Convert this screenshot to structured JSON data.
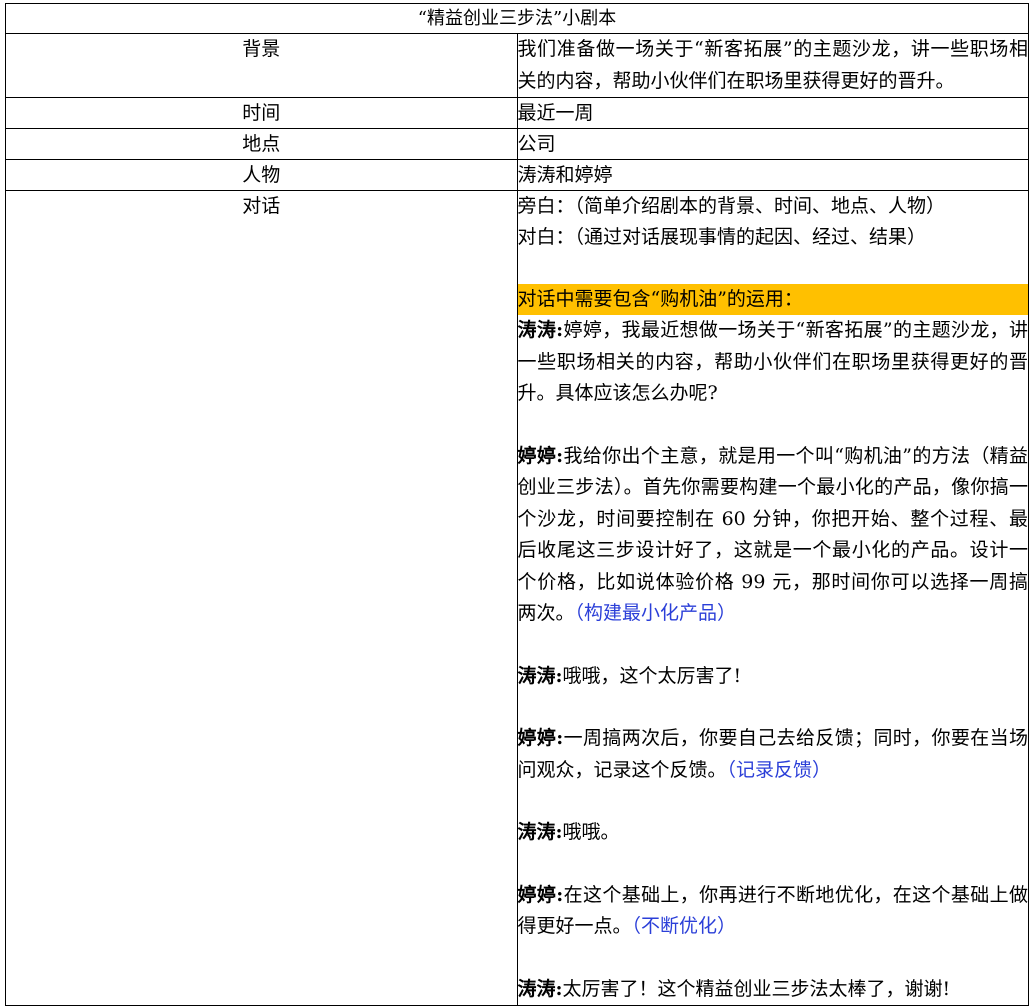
{
  "title": "“精益创业三步法”小剧本",
  "rows": {
    "background": {
      "label": "背景",
      "value": "我们准备做一场关于“新客拓展”的主题沙龙，讲一些职场相关的内容，帮助小伙伴们在职场里获得更好的晋升。"
    },
    "time": {
      "label": "时间",
      "value": "最近一周"
    },
    "place": {
      "label": "地点",
      "value": "公司"
    },
    "characters": {
      "label": "人物",
      "value": "涛涛和婷婷"
    },
    "dialogue": {
      "label": "对话"
    }
  },
  "dialogue": {
    "narration": "旁白：（简单介绍剧本的背景、时间、地点、人物）",
    "dialog_note": "对白：（通过对话展现事情的起因、经过、结果）",
    "requirement": "对话中需要包含“购机油”的运用：",
    "lines": [
      {
        "speaker": "涛涛:",
        "text": "婷婷，我最近想做一场关于“新客拓展”的主题沙龙，讲一些职场相关的内容，帮助小伙伴们在职场里获得更好的晋升。具体应该怎么办呢?",
        "note": ""
      },
      {
        "speaker": "婷婷:",
        "text": "我给你出个主意，就是用一个叫“购机油”的方法（精益创业三步法）。首先你需要构建一个最小化的产品，像你搞一个沙龙，时间要控制在 60 分钟，你把开始、整个过程、最后收尾这三步设计好了，这就是一个最小化的产品。设计一个价格，比如说体验价格 99 元，那时间你可以选择一周搞两次。",
        "note": "（构建最小化产品）"
      },
      {
        "speaker": "涛涛:",
        "text": "哦哦，这个太厉害了!",
        "note": ""
      },
      {
        "speaker": "婷婷:",
        "text": "一周搞两次后，你要自己去给反馈；同时，你要在当场问观众，记录这个反馈。",
        "note": "（记录反馈）"
      },
      {
        "speaker": "涛涛:",
        "text": "哦哦。",
        "note": ""
      },
      {
        "speaker": "婷婷:",
        "text": "在这个基础上，你再进行不断地优化，在这个基础上做得更好一点。",
        "note": "（不断优化）"
      },
      {
        "speaker": "涛涛:",
        "text": "太厉害了！这个精益创业三步法太棒了，谢谢!",
        "note": ""
      }
    ]
  },
  "colors": {
    "highlight": "#ffc000",
    "note": "#2b3fd8",
    "border": "#000000"
  }
}
